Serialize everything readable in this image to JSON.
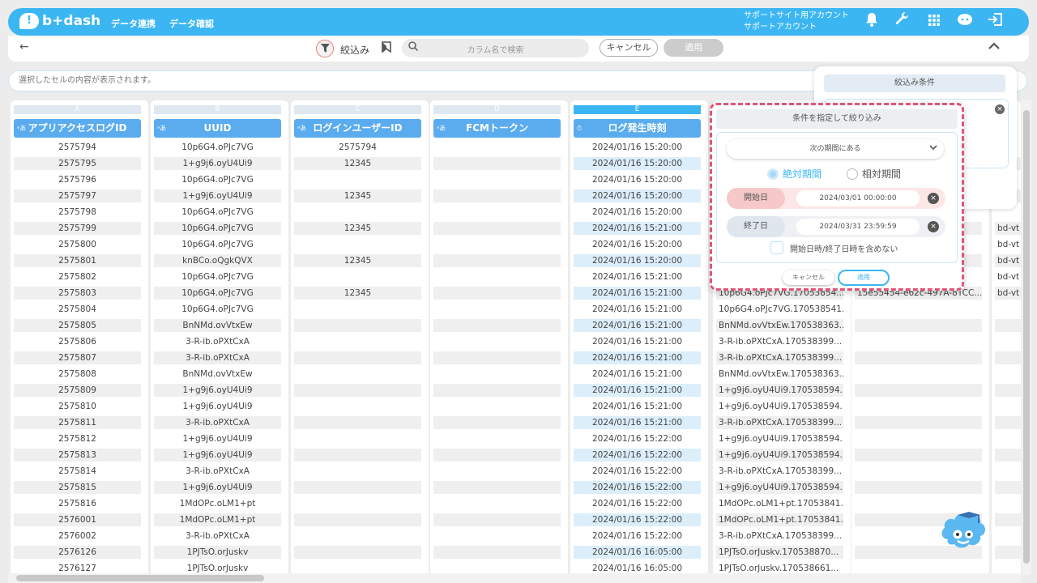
{
  "app": {
    "brand": "b+dash",
    "nav": [
      "データ連携",
      "データ確認"
    ],
    "account_line1": "サポートサイト用アカウント",
    "account_line2": "サポートアカウント"
  },
  "toolbar": {
    "filter_label": "絞込み",
    "search_placeholder": "カラム名で検索",
    "cancel": "キャンセル",
    "apply": "適用"
  },
  "cell_display_placeholder": "選択したセルの内容が表示されます。",
  "filter_conditions": {
    "title": "絞込み条件"
  },
  "columns": [
    {
      "letter": "A",
      "type": "ᵃあ",
      "name": "アプリアクセスログID"
    },
    {
      "letter": "B",
      "type": "ᵃあ",
      "name": "UUID"
    },
    {
      "letter": "C",
      "type": "ᵃあ",
      "name": "ログインユーザーID"
    },
    {
      "letter": "D",
      "type": "ᵃあ",
      "name": "FCMトークン"
    },
    {
      "letter": "E",
      "type": "⏱",
      "name": "ログ発生時刻"
    }
  ],
  "col_a": [
    "2575794",
    "2575795",
    "2575796",
    "2575797",
    "2575798",
    "2575799",
    "2575800",
    "2575801",
    "2575802",
    "2575803",
    "2575804",
    "2575805",
    "2575806",
    "2575807",
    "2575808",
    "2575809",
    "2575810",
    "2575811",
    "2575812",
    "2575813",
    "2575814",
    "2575815",
    "2575816",
    "2576001",
    "2576002",
    "2576126",
    "2576127"
  ],
  "col_b": [
    "10p6G4.oPJc7VG",
    "1+g9j6.oyU4Ui9",
    "10p6G4.oPJc7VG",
    "1+g9j6.oyU4Ui9",
    "10p6G4.oPJc7VG",
    "10p6G4.oPJc7VG",
    "10p6G4.oPJc7VG",
    "knBCo.oQgkQVX",
    "10p6G4.oPJc7VG",
    "10p6G4.oPJc7VG",
    "10p6G4.oPJc7VG",
    "BnNMd.ovVtxEw",
    "3-R-ib.oPXtCxA",
    "3-R-ib.oPXtCxA",
    "BnNMd.ovVtxEw",
    "1+g9j6.oyU4Ui9",
    "1+g9j6.oyU4Ui9",
    "3-R-ib.oPXtCxA",
    "1+g9j6.oyU4Ui9",
    "1+g9j6.oyU4Ui9",
    "3-R-ib.oPXtCxA",
    "1+g9j6.oyU4Ui9",
    "1MdOPc.oLM1+pt",
    "1MdOPc.oLM1+pt",
    "3-R-ib.oPXtCxA",
    "1PJTsO.orJuskv",
    "1PJTsO.orJuskv"
  ],
  "col_c": [
    "2575794",
    "12345",
    "",
    "12345",
    "",
    "12345",
    "",
    "12345",
    "",
    "12345",
    "",
    "",
    "",
    "",
    "",
    "",
    "",
    "",
    "",
    "",
    "",
    "",
    "",
    "",
    "",
    "",
    ""
  ],
  "col_e": [
    "2024/01/16 15:20:00",
    "2024/01/16 15:20:00",
    "2024/01/16 15:20:00",
    "2024/01/16 15:20:00",
    "2024/01/16 15:20:00",
    "2024/01/16 15:21:00",
    "2024/01/16 15:20:00",
    "2024/01/16 15:20:00",
    "2024/01/16 15:21:00",
    "2024/01/16 15:21:00",
    "2024/01/16 15:21:00",
    "2024/01/16 15:21:00",
    "2024/01/16 15:21:00",
    "2024/01/16 15:21:00",
    "2024/01/16 15:21:00",
    "2024/01/16 15:21:00",
    "2024/01/16 15:21:00",
    "2024/01/16 15:21:00",
    "2024/01/16 15:22:00",
    "2024/01/16 15:22:00",
    "2024/01/16 15:22:00",
    "2024/01/16 15:22:00",
    "2024/01/16 15:22:00",
    "2024/01/16 15:22:00",
    "2024/01/16 15:22:00",
    "2024/01/16 16:05:00",
    "2024/01/16 16:05:00"
  ],
  "col_f_visible": [
    "",
    "",
    "",
    "",
    "",
    "",
    "",
    "",
    "",
    "10p6G4.oPJc7VG.17053854...",
    "10p6G4.oPJc7VG.170538541...",
    "BnNMd.ovVtxEw.170538363...",
    "3-R-ib.oPXtCxA.170538399...",
    "3-R-ib.oPXtCxA.170538399...",
    "BnNMd.ovVtxEw.170538363...",
    "1+g9j6.oyU4Ui9.170538594...",
    "1+g9j6.oyU4Ui9.170538594...",
    "3-R-ib.oPXtCxA.170538399...",
    "1+g9j6.oyU4Ui9.170538594...",
    "1+g9j6.oyU4Ui9.170538594...",
    "3-R-ib.oPXtCxA.170538399...",
    "1+g9j6.oyU4Ui9.170538594...",
    "1MdOPc.oLM1+pt.17053841...",
    "1MdOPc.oLM1+pt.17053841...",
    "3-R-ib.oPXtCxA.170538399...",
    "1PJTsO.orJuskv.170538870...",
    "1PJTsO.orJuskv.170538661..."
  ],
  "col_g_partial": [
    "",
    "",
    "",
    "",
    "",
    "",
    "",
    "",
    "",
    "15e55454-e62c-497A-8TCC..."
  ],
  "col_h_partial": [
    "",
    "",
    "",
    "",
    "",
    "bd-vt",
    "bd-vt",
    "bd-vt",
    "bd-vt",
    "bd-vt"
  ],
  "popup": {
    "title": "条件を指定して絞り込み",
    "period_option": "次の期間にある",
    "radio_absolute": "絶対期間",
    "radio_relative": "相対期間",
    "start_label": "開始日",
    "start_value": "2024/03/01 00:00:00",
    "end_label": "終了日",
    "end_value": "2024/03/31 23:59:59",
    "exclude_label": "開始日時/終了日時を含めない",
    "cancel": "キャンセル",
    "apply": "適用"
  },
  "colors": {
    "brand": "#3bb6f2",
    "header": "#5aacee",
    "highlight": "#e05577"
  }
}
